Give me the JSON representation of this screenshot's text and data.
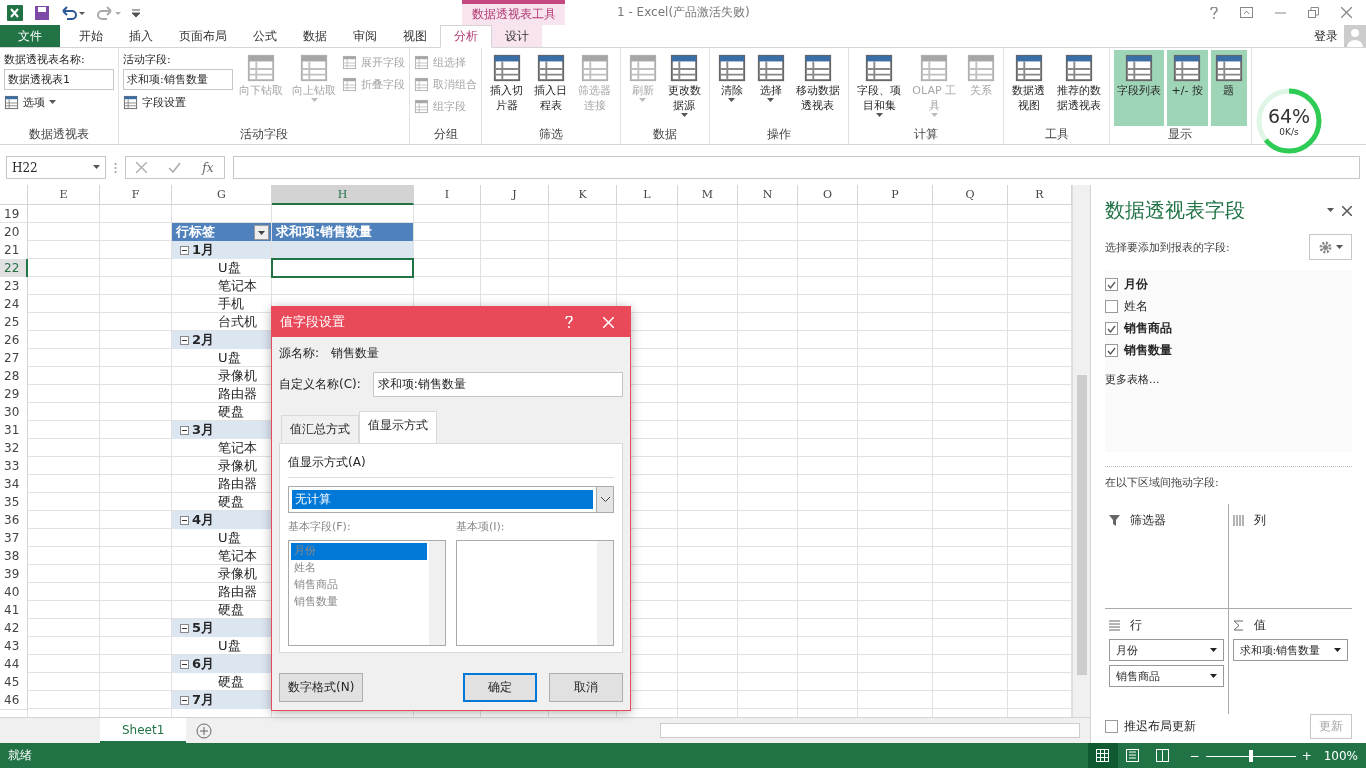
{
  "title_bar": {
    "context_label": "数据透视表工具",
    "title": "1 - Excel(产品激活失败)"
  },
  "tabs": [
    {
      "label": "文件",
      "kind": "file",
      "selected": false
    },
    {
      "label": "开始",
      "kind": "normal",
      "selected": false
    },
    {
      "label": "插入",
      "kind": "normal",
      "selected": false
    },
    {
      "label": "页面布局",
      "kind": "normal",
      "selected": false
    },
    {
      "label": "公式",
      "kind": "normal",
      "selected": false
    },
    {
      "label": "数据",
      "kind": "normal",
      "selected": false
    },
    {
      "label": "审阅",
      "kind": "normal",
      "selected": false
    },
    {
      "label": "视图",
      "kind": "normal",
      "selected": false
    },
    {
      "label": "分析",
      "kind": "context",
      "selected": true
    },
    {
      "label": "设计",
      "kind": "context",
      "selected": false
    }
  ],
  "account": "登录",
  "ribbon": [
    {
      "label": "数据透视表",
      "items": [
        {
          "kind": "stack",
          "items": [
            {
              "kind": "field",
              "label": "数据透视表名称:",
              "value": "数据透视表1"
            },
            {
              "kind": "small",
              "label": "选项",
              "menu": true,
              "disabled": false
            }
          ]
        }
      ]
    },
    {
      "label": "活动字段",
      "items": [
        {
          "kind": "stack",
          "items": [
            {
              "kind": "field",
              "label": "活动字段:",
              "value": "求和项:销售数量"
            },
            {
              "kind": "small",
              "label": "字段设置",
              "menu": false,
              "disabled": false
            }
          ]
        },
        {
          "kind": "large",
          "label": "向下钻取",
          "menu": false,
          "disabled": true
        },
        {
          "kind": "large",
          "label": "向上钻取",
          "menu": true,
          "disabled": true
        },
        {
          "kind": "stack",
          "items": [
            {
              "kind": "small",
              "label": "展开字段",
              "menu": false,
              "disabled": true
            },
            {
              "kind": "small",
              "label": "折叠字段",
              "menu": false,
              "disabled": true
            }
          ]
        }
      ]
    },
    {
      "label": "分组",
      "items": [
        {
          "kind": "stack",
          "items": [
            {
              "kind": "small",
              "label": "组选择",
              "menu": false,
              "disabled": true
            },
            {
              "kind": "small",
              "label": "取消组合",
              "menu": false,
              "disabled": true
            },
            {
              "kind": "small",
              "label": "组字段",
              "menu": false,
              "disabled": true
            }
          ]
        }
      ]
    },
    {
      "label": "筛选",
      "items": [
        {
          "kind": "large",
          "label": "插入切片器",
          "menu": false,
          "disabled": false
        },
        {
          "kind": "large",
          "label": "插入日程表",
          "menu": false,
          "disabled": false
        },
        {
          "kind": "large",
          "label": "筛选器连接",
          "menu": false,
          "disabled": true
        }
      ]
    },
    {
      "label": "数据",
      "items": [
        {
          "kind": "large",
          "label": "刷新",
          "menu": true,
          "disabled": true
        },
        {
          "kind": "large",
          "label": "更改数据源",
          "menu": true,
          "disabled": false
        }
      ]
    },
    {
      "label": "操作",
      "items": [
        {
          "kind": "large",
          "label": "清除",
          "menu": true,
          "disabled": false
        },
        {
          "kind": "large",
          "label": "选择",
          "menu": true,
          "disabled": false
        },
        {
          "kind": "large",
          "label": "移动数据透视表",
          "menu": false,
          "disabled": false
        }
      ]
    },
    {
      "label": "计算",
      "items": [
        {
          "kind": "large",
          "label": "字段、项目和集",
          "menu": true,
          "disabled": false
        },
        {
          "kind": "large",
          "label": "OLAP 工具",
          "menu": true,
          "disabled": true
        },
        {
          "kind": "large",
          "label": "关系",
          "menu": false,
          "disabled": true
        }
      ]
    },
    {
      "label": "工具",
      "items": [
        {
          "kind": "large",
          "label": "数据透视图",
          "menu": false,
          "disabled": false
        },
        {
          "kind": "large",
          "label": "推荐的数据透视表",
          "menu": false,
          "disabled": false
        }
      ]
    },
    {
      "label": "显示",
      "items": [
        {
          "kind": "large",
          "label": "字段列表",
          "menu": false,
          "disabled": false,
          "on": true
        },
        {
          "kind": "large",
          "label": "+/- 按",
          "menu": false,
          "disabled": false,
          "on": true
        },
        {
          "kind": "large",
          "label": "题",
          "menu": false,
          "disabled": false,
          "on": true
        }
      ]
    }
  ],
  "formula_bar": {
    "name_box": "H22",
    "function_label": "fx"
  },
  "sheet": {
    "columns": [
      {
        "label": "E",
        "selected": false
      },
      {
        "label": "F",
        "selected": false
      },
      {
        "label": "G",
        "selected": false
      },
      {
        "label": "H",
        "selected": true
      },
      {
        "label": "I",
        "selected": false
      },
      {
        "label": "J",
        "selected": false
      },
      {
        "label": "K",
        "selected": false
      },
      {
        "label": "L",
        "selected": false
      },
      {
        "label": "M",
        "selected": false
      },
      {
        "label": "N",
        "selected": false
      },
      {
        "label": "O",
        "selected": false
      },
      {
        "label": "P",
        "selected": false
      },
      {
        "label": "Q",
        "selected": false
      },
      {
        "label": "R",
        "selected": false
      }
    ],
    "rows": [
      {
        "number": "19",
        "kind": "blank",
        "selected": false
      },
      {
        "number": "20",
        "kind": "header",
        "label": "行标签",
        "value_label": "求和项:销售数量",
        "selected": false
      },
      {
        "number": "21",
        "kind": "month",
        "label": "1月",
        "selected": false
      },
      {
        "number": "22",
        "kind": "item",
        "label": "U盘",
        "selected": true
      },
      {
        "number": "23",
        "kind": "item",
        "label": "笔记本",
        "selected": false
      },
      {
        "number": "24",
        "kind": "item",
        "label": "手机",
        "selected": false
      },
      {
        "number": "25",
        "kind": "item",
        "label": "台式机",
        "selected": false
      },
      {
        "number": "26",
        "kind": "month",
        "label": "2月",
        "selected": false
      },
      {
        "number": "27",
        "kind": "item",
        "label": "U盘",
        "selected": false
      },
      {
        "number": "28",
        "kind": "item",
        "label": "录像机",
        "selected": false
      },
      {
        "number": "29",
        "kind": "item",
        "label": "路由器",
        "selected": false
      },
      {
        "number": "30",
        "kind": "item",
        "label": "硬盘",
        "selected": false
      },
      {
        "number": "31",
        "kind": "month",
        "label": "3月",
        "selected": false
      },
      {
        "number": "32",
        "kind": "item",
        "label": "笔记本",
        "selected": false
      },
      {
        "number": "33",
        "kind": "item",
        "label": "录像机",
        "selected": false
      },
      {
        "number": "34",
        "kind": "item",
        "label": "路由器",
        "selected": false
      },
      {
        "number": "35",
        "kind": "item",
        "label": "硬盘",
        "selected": false
      },
      {
        "number": "36",
        "kind": "month",
        "label": "4月",
        "selected": false
      },
      {
        "number": "37",
        "kind": "item",
        "label": "U盘",
        "selected": false
      },
      {
        "number": "38",
        "kind": "item",
        "label": "笔记本",
        "selected": false
      },
      {
        "number": "39",
        "kind": "item",
        "label": "录像机",
        "selected": false
      },
      {
        "number": "40",
        "kind": "item",
        "label": "路由器",
        "selected": false
      },
      {
        "number": "41",
        "kind": "item",
        "label": "硬盘",
        "selected": false
      },
      {
        "number": "42",
        "kind": "month",
        "label": "5月",
        "selected": false
      },
      {
        "number": "43",
        "kind": "item",
        "label": "U盘",
        "selected": false
      },
      {
        "number": "44",
        "kind": "month",
        "label": "6月",
        "selected": false
      },
      {
        "number": "45",
        "kind": "item",
        "label": "硬盘",
        "selected": false
      },
      {
        "number": "46",
        "kind": "month",
        "label": "7月",
        "selected": false
      }
    ],
    "sheet_tabs": [
      {
        "label": "Sheet1",
        "selected": true
      }
    ]
  },
  "dialog": {
    "title": "值字段设置",
    "source_label": "源名称:",
    "source_value": "销售数量",
    "custom_label": "自定义名称(C):",
    "custom_value": "求和项:销售数量",
    "tabs": [
      {
        "label": "值汇总方式",
        "selected": false
      },
      {
        "label": "值显示方式",
        "selected": true
      }
    ],
    "show_as_label": "值显示方式(A)",
    "show_as_value": "无计算",
    "base_field_label": "基本字段(F):",
    "base_item_label": "基本项(I):",
    "base_fields": [
      {
        "label": "月份",
        "selected": true
      },
      {
        "label": "姓名",
        "selected": false
      },
      {
        "label": "销售商品",
        "selected": false
      },
      {
        "label": "销售数量",
        "selected": false
      }
    ],
    "buttons": [
      {
        "label": "数字格式(N)",
        "default": false
      },
      {
        "label": "确定",
        "default": true
      },
      {
        "label": "取消",
        "default": false
      }
    ]
  },
  "field_panel": {
    "title": "数据透视表字段",
    "subtitle": "选择要添加到报表的字段:",
    "fields": [
      {
        "label": "月份",
        "checked": true
      },
      {
        "label": "姓名",
        "checked": false
      },
      {
        "label": "销售商品",
        "checked": true
      },
      {
        "label": "销售数量",
        "checked": true
      }
    ],
    "more_tables": "更多表格...",
    "drag_hint": "在以下区域间拖动字段:",
    "areas": [
      {
        "label": "筛选器",
        "kind": "filter"
      },
      {
        "label": "列",
        "kind": "columns"
      },
      {
        "label": "行",
        "kind": "rows",
        "items": [
          "月份",
          "销售商品"
        ]
      },
      {
        "label": "值",
        "kind": "values",
        "items": [
          "求和项:销售数量"
        ]
      }
    ],
    "defer_label": "推迟布局更新",
    "defer_checked": false,
    "update_button": "更新"
  },
  "status_bar": {
    "status": "就绪",
    "views": [
      {
        "selected": true
      },
      {
        "selected": false
      },
      {
        "selected": false
      }
    ],
    "zoom_out": "−",
    "zoom_slider": {
      "level": 0.5
    },
    "zoom_in": "+",
    "zoom": "100%"
  },
  "net_widget": {
    "percent": "64%",
    "level": 0.64,
    "speed": "0K/s"
  }
}
